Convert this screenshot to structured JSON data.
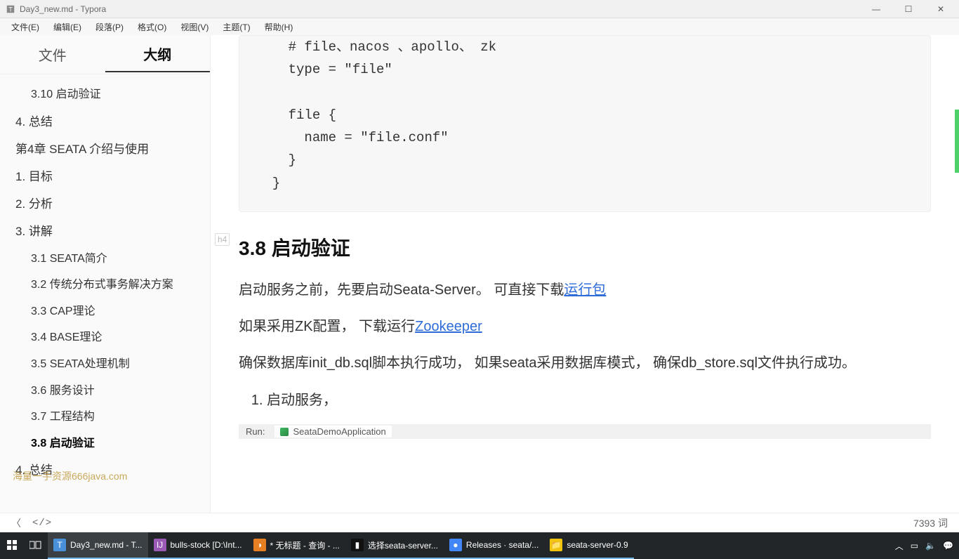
{
  "window": {
    "title": "Day3_new.md - Typora"
  },
  "menu": [
    "文件(E)",
    "编辑(E)",
    "段落(P)",
    "格式(O)",
    "视图(V)",
    "主题(T)",
    "帮助(H)"
  ],
  "tabs": {
    "files": "文件",
    "outline": "大纲"
  },
  "outline": [
    {
      "label": "3.10 启动验证",
      "level": 2
    },
    {
      "label": "4. 总结",
      "level": 1
    },
    {
      "label": "第4章 SEATA 介绍与使用",
      "level": 1
    },
    {
      "label": "1. 目标",
      "level": 1
    },
    {
      "label": "2. 分析",
      "level": 1
    },
    {
      "label": "3. 讲解",
      "level": 1
    },
    {
      "label": "3.1 SEATA简介",
      "level": 2
    },
    {
      "label": "3.2 传统分布式事务解决方案",
      "level": 2
    },
    {
      "label": "3.3 CAP理论",
      "level": 2
    },
    {
      "label": "3.4 BASE理论",
      "level": 2
    },
    {
      "label": "3.5 SEATA处理机制",
      "level": 2
    },
    {
      "label": "3.6 服务设计",
      "level": 2
    },
    {
      "label": "3.7 工程结构",
      "level": 2
    },
    {
      "label": "3.8 启动验证",
      "level": 2,
      "active": true
    },
    {
      "label": "4. 总结",
      "level": 1
    }
  ],
  "code": "    # file、nacos 、apollo、 zk\n    type = \"file\"\n\n    file {\n      name = \"file.conf\"\n    }\n  }",
  "heading": "3.8 启动验证",
  "heading_gutter": "h4",
  "para1_a": "启动服务之前，先要启动Seata-Server。 可直接下载",
  "para1_link": "运行包",
  "para2_a": "如果采用ZK配置， 下载运行",
  "para2_link": "Zookeeper",
  "para3": "确保数据库init_db.sql脚本执行成功， 如果seata采用数据库模式， 确保db_store.sql文件执行成功。",
  "list1": "启动服务，",
  "run": {
    "label": "Run:",
    "app": "SeataDemoApplication"
  },
  "status": {
    "back": "〈",
    "code": "</>",
    "words": "7393 词"
  },
  "watermark": "海量一手资源666java.com",
  "taskbar": {
    "items": [
      {
        "label": "Day3_new.md - T...",
        "color": "#4a90d9",
        "glyph": "T"
      },
      {
        "label": "bulls-stock [D:\\Int...",
        "color": "#9b59b6",
        "glyph": "IJ"
      },
      {
        "label": "* 无标题 - 查询 - ...",
        "color": "#e67e22",
        "glyph": "◑"
      },
      {
        "label": "选择seata-server...",
        "color": "#111",
        "glyph": "▮"
      },
      {
        "label": "Releases · seata/...",
        "color": "#4285f4",
        "glyph": "●"
      },
      {
        "label": "seata-server-0.9",
        "color": "#f1c40f",
        "glyph": "📁"
      }
    ]
  }
}
